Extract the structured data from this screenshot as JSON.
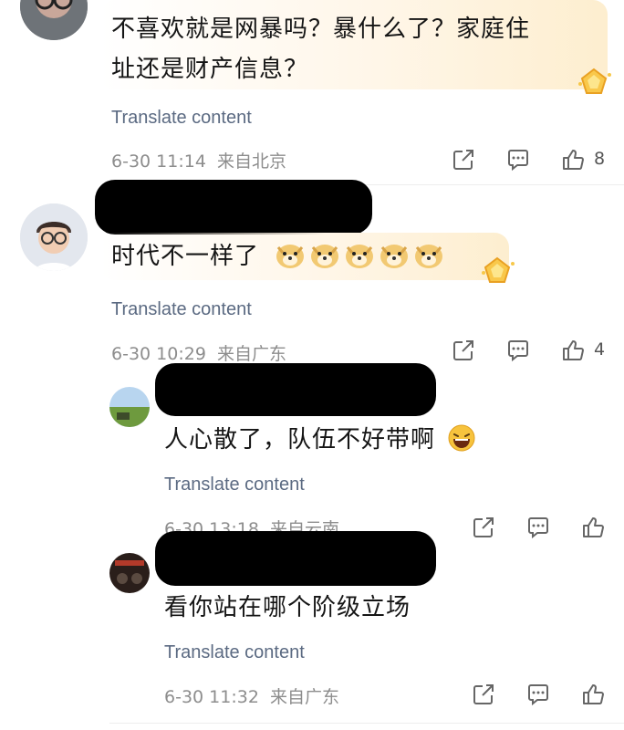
{
  "translate_label": "Translate content",
  "comments": [
    {
      "text": "不喜欢就是网暴吗？暴什么了？家庭住址还是财产信息？",
      "line1": "不喜欢就是网暴吗？暴什么了？家庭住",
      "line2": "址还是财产信息？",
      "date": "6-30 11:14",
      "location": "来自北京",
      "likes": "8"
    },
    {
      "text": "时代不一样了",
      "emojis": [
        "doge",
        "doge",
        "doge",
        "doge",
        "doge"
      ],
      "date": "6-30 10:29",
      "location": "来自广东",
      "likes": "4"
    },
    {
      "text": "人心散了，队伍不好带啊",
      "emoji": "laughing-face",
      "date": "6-30 13:18",
      "location": "来自云南",
      "likes": ""
    },
    {
      "text": "看你站在哪个阶级立场",
      "date": "6-30 11:32",
      "location": "来自广东",
      "likes": ""
    }
  ],
  "colors": {
    "translate": "#5b6a82",
    "meta": "#8d8d8d",
    "bubble": "#fdeecf",
    "badge": "#f7b93a"
  }
}
